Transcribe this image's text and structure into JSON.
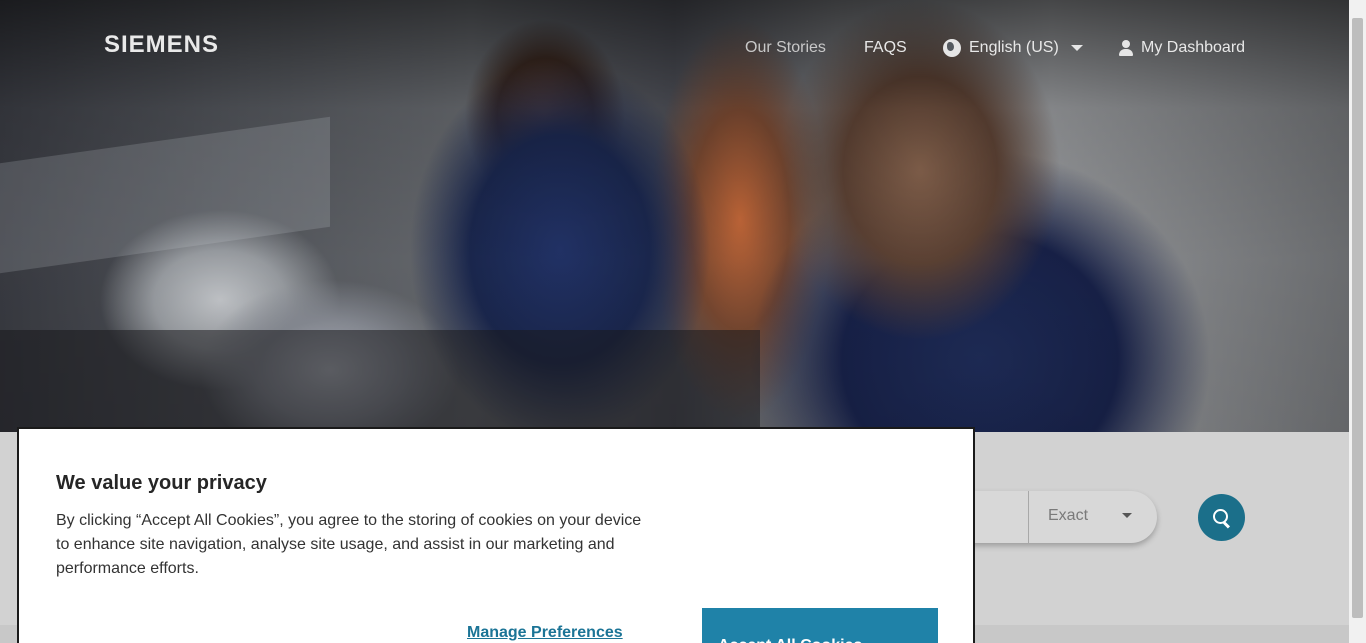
{
  "brand": {
    "logo_text": "SIEMENS",
    "accent": "#1f82a8"
  },
  "nav": {
    "items": [
      {
        "label": "Our Stories"
      },
      {
        "label": "FAQS"
      },
      {
        "label": "English (US)",
        "icon": "globe-icon"
      },
      {
        "label": "My Dashboard",
        "icon": "user-icon"
      }
    ]
  },
  "search": {
    "match_mode": "Exact"
  },
  "cookie_banner": {
    "title": "We value your privacy",
    "body": "By clicking “Accept All Cookies”, you agree to the storing of cookies on your device to enhance site navigation, analyse site usage, and assist in our marketing and performance efforts.",
    "manage_label": "Manage Preferences",
    "accept_label": "Accept All Cookies"
  }
}
